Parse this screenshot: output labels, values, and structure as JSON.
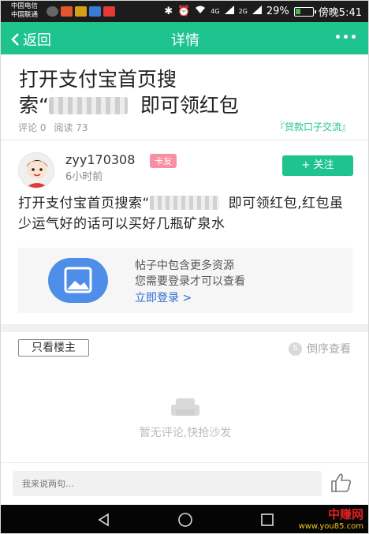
{
  "status_bar": {
    "carrier_1": "中国电信",
    "carrier_2": "中国联通",
    "network": "4G",
    "network_2": "2G",
    "battery": "29%",
    "battery_level": 0.29,
    "time": "傍晚5:41"
  },
  "nav": {
    "back_label": "返回",
    "title": "详情"
  },
  "post": {
    "title_a": "打开支付宝首页搜",
    "title_b": "索“",
    "title_c": "即可领红包",
    "comments": "评论 0",
    "reads": "阅读 73",
    "source": "『贷款口子交流』",
    "author": "zyy170308",
    "badge": "卡友",
    "time_ago": "6小时前",
    "follow_label": "+ 关注",
    "body_a": "打开支付宝首页搜索“",
    "body_b": "即可领红包,红包虽少运气好的话可以买好几瓶矿泉水"
  },
  "resource_card": {
    "line1": "帖子中包含更多资源",
    "line2": "您需要登录才可以查看",
    "link": "立即登录 >"
  },
  "comments_section": {
    "only_host": "只看楼主",
    "reverse": "倒序查看",
    "empty": "暂无评论,快抢沙发"
  },
  "input": {
    "placeholder": "我来说两句..."
  },
  "watermark": {
    "line1": "中赚网",
    "line2": "www.you85.com"
  }
}
